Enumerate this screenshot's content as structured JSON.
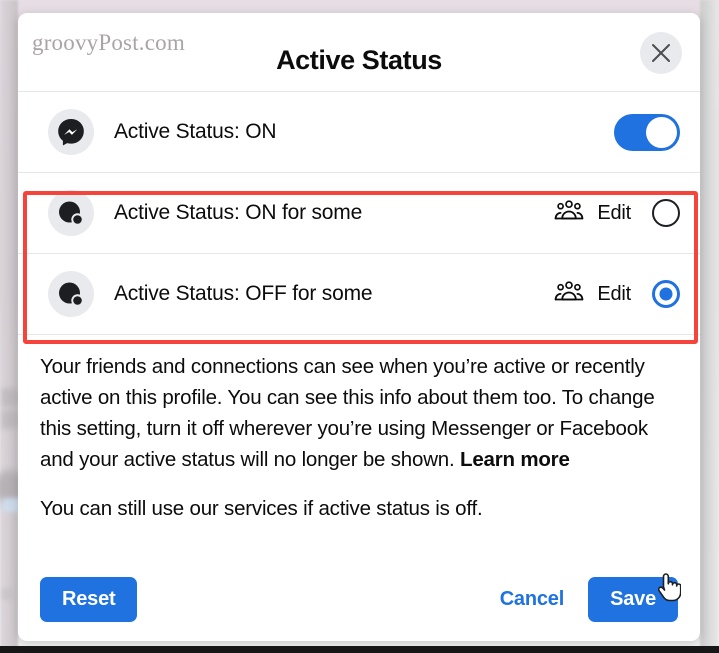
{
  "watermark": "groovyPost.com",
  "dialog": {
    "title": "Active Status",
    "close_icon": "close-icon"
  },
  "rows": [
    {
      "id": "active-status-on",
      "icon": "messenger-icon",
      "label": "Active Status: ON",
      "control": "toggle",
      "toggle_on": true,
      "has_edit": false
    },
    {
      "id": "active-status-on-for-some",
      "icon": "partial-status-icon",
      "label": "Active Status: ON for some",
      "control": "radio",
      "selected": false,
      "has_edit": true,
      "people_icon": "people-group-icon",
      "edit_label": "Edit"
    },
    {
      "id": "active-status-off-for-some",
      "icon": "partial-status-icon",
      "label": "Active Status: OFF for some",
      "control": "radio",
      "selected": true,
      "has_edit": true,
      "people_icon": "people-group-icon",
      "edit_label": "Edit"
    }
  ],
  "body": {
    "paragraph1_part1": "Your friends and connections can see when you’re active or recently active on this profile. You can see this info about them too. To change this setting, turn it off wherever you’re using Messenger or Facebook and your active status will no longer be shown. ",
    "learn_more": "Learn more",
    "paragraph2": "You can still use our services if active status is off."
  },
  "footer": {
    "reset_label": "Reset",
    "cancel_label": "Cancel",
    "save_label": "Save"
  },
  "colors": {
    "accent_blue": "#1f72e0",
    "highlight_red": "#f4443c",
    "icon_gray": "#e9eaed",
    "text_dark": "#0c0c0d"
  }
}
